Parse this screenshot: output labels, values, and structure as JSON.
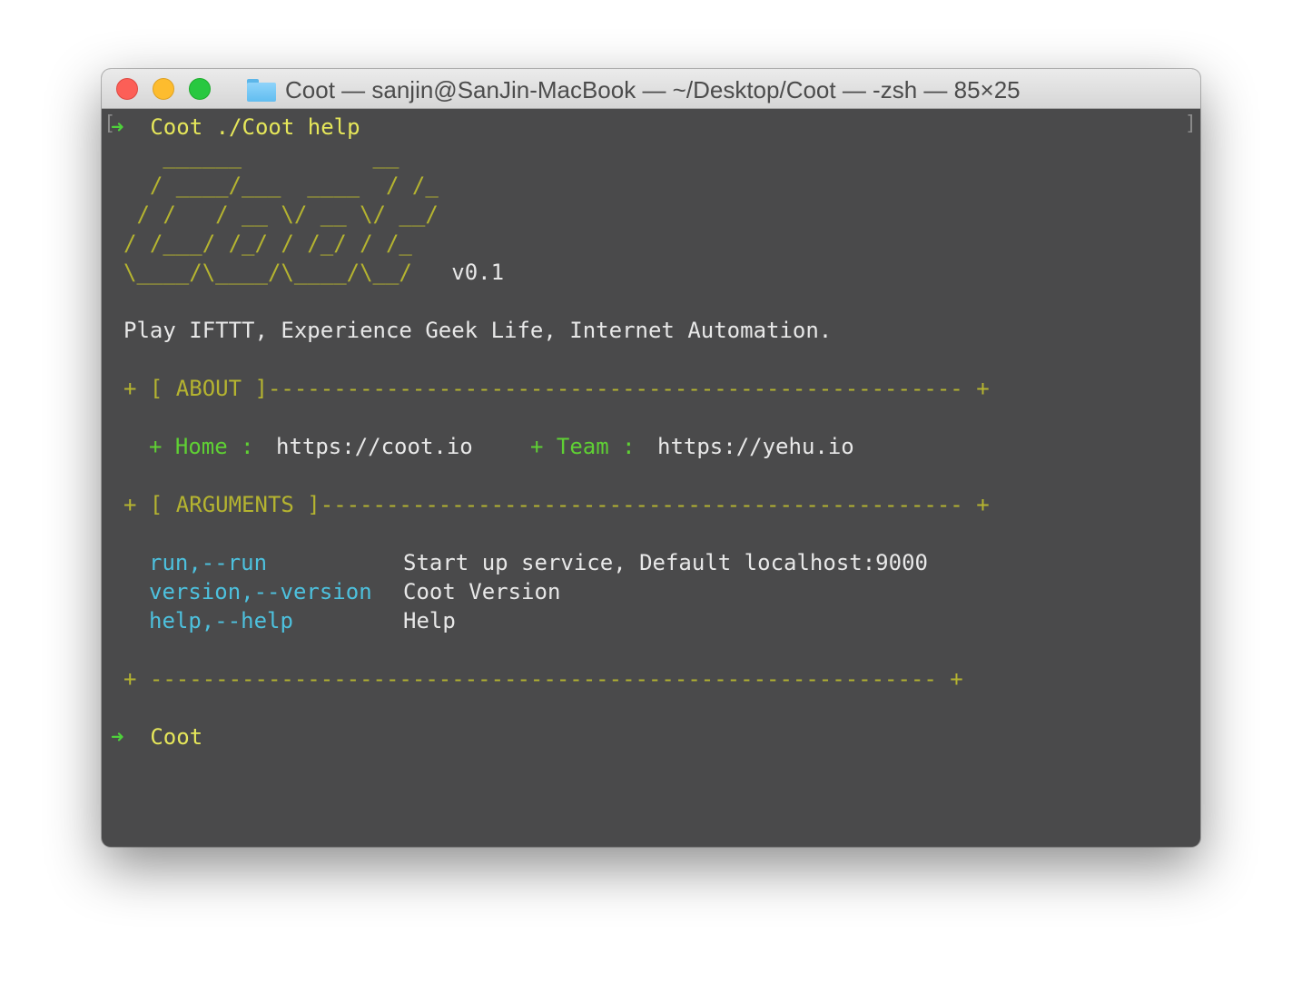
{
  "window": {
    "title": "Coot — sanjin@SanJin-MacBook — ~/Desktop/Coot — -zsh — 85×25",
    "folder_icon": "folder-icon"
  },
  "terminal": {
    "prompt_arrow": "➜",
    "prompt_dir": "Coot",
    "command": "./Coot help",
    "open_bracket": "[",
    "close_bracket": "]",
    "logo": [
      "   ______          __",
      "  / ____/___  ____  / /_",
      " / /   / __ \\/ __ \\/ __/",
      "/ /___/ /_/ / /_/ / /_",
      "\\____/\\____/\\____/\\__/"
    ],
    "version": "v0.1",
    "tagline": "Play IFTTT, Experience Geek Life, Internet Automation.",
    "about_header": "+ [ ABOUT ]----------------------------------------------------- +",
    "home_label": "+ Home :",
    "home_url": "https://coot.io",
    "team_label": "+ Team :",
    "team_url": "https://yehu.io",
    "arguments_header": "+ [ ARGUMENTS ]------------------------------------------------- +",
    "arguments": [
      {
        "flag": "run,--run",
        "desc": "Start up service, Default localhost:9000"
      },
      {
        "flag": "version,--version",
        "desc": "Coot Version"
      },
      {
        "flag": "help,--help",
        "desc": "Help"
      }
    ],
    "footer_rule": "+ ------------------------------------------------------------ +",
    "final_prompt_dir": "Coot"
  },
  "colors": {
    "background": "#4a4a4b",
    "prompt_yellow": "#e6e75a",
    "box_yellow": "#b5b430",
    "label_green": "#5fd034",
    "flag_cyan": "#4dc1de"
  }
}
